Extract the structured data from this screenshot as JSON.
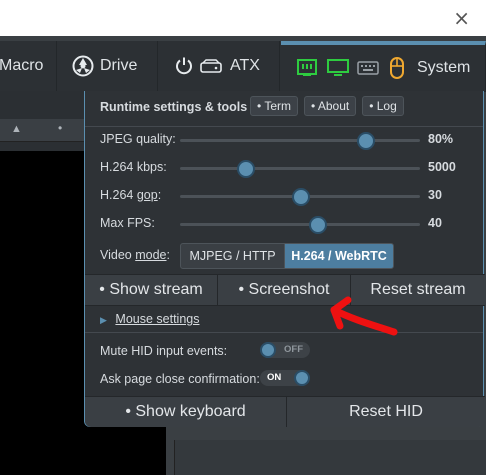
{
  "close_glyph": "×",
  "navbar": {
    "macro": "Macro",
    "drive": "Drive",
    "atx": "ATX",
    "system": "System"
  },
  "panel": {
    "header": "Runtime settings & tools",
    "header_buttons": [
      "• Term",
      "• About",
      "• Log"
    ],
    "sliders": [
      {
        "label": "JPEG quality:",
        "value": "80%",
        "fraction": 0.77
      },
      {
        "label": "H.264 kbps:",
        "value": "5000",
        "fraction": 0.27
      },
      {
        "label": "H.264 ",
        "label_ul": "gop",
        "label_end": ":",
        "value": "30",
        "fraction": 0.5
      },
      {
        "label": "Max FPS:",
        "value": "40",
        "fraction": 0.57
      }
    ],
    "video_mode": {
      "label": "Video ",
      "label_ul": "mode",
      "label_end": ":",
      "options": [
        "MJPEG / HTTP",
        "H.264 / WebRTC"
      ],
      "selected": "H.264 / WebRTC"
    },
    "stream_buttons": [
      "• Show stream",
      "• Screenshot",
      "Reset stream"
    ],
    "mouse_settings": "Mouse settings",
    "mute_hid": {
      "label": "Mute HID input events:",
      "state": "OFF"
    },
    "page_close": {
      "label": "Ask page close confirmation:",
      "state": "ON"
    },
    "bottom_buttons": [
      "• Show keyboard",
      "Reset HID"
    ]
  },
  "colors": {
    "accent": "#5b8fb0",
    "arrow": "#ee1111"
  }
}
